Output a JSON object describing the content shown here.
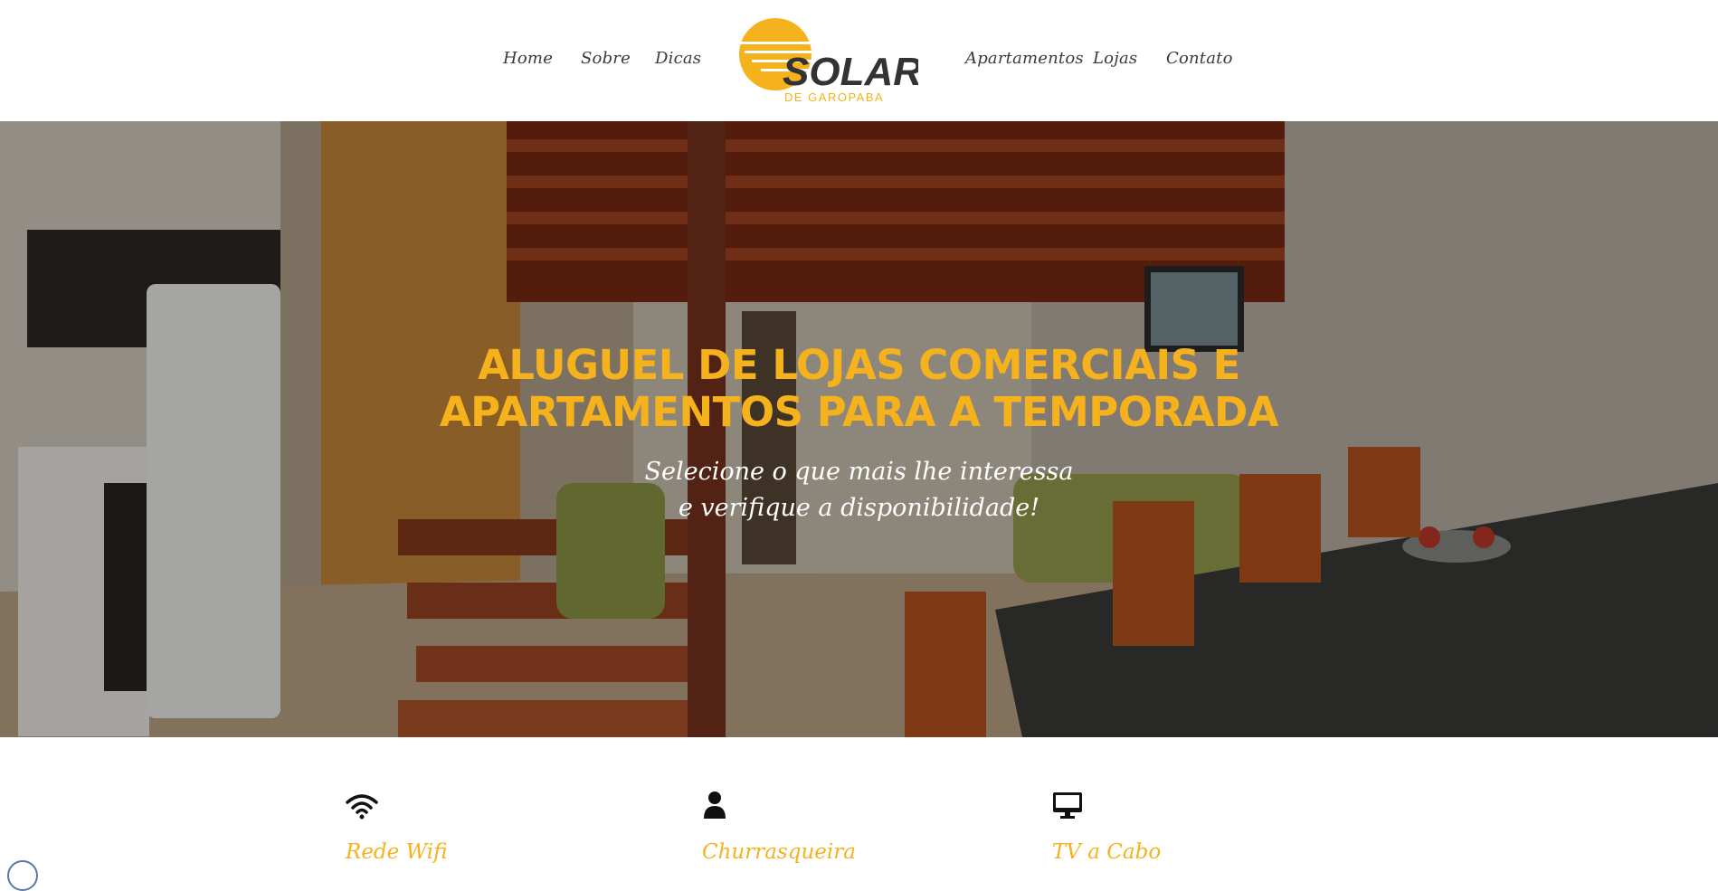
{
  "nav": {
    "left": [
      "Home",
      "Sobre",
      "Dicas"
    ],
    "right": [
      "Apartamentos",
      "Lojas",
      "Contato"
    ]
  },
  "logo": {
    "name": "SOLAR",
    "tagline": "DE GAROPABA"
  },
  "hero": {
    "title_line1": "ALUGUEL DE LOJAS COMERCIAIS E",
    "title_line2": "APARTAMENTOS PARA A TEMPORADA",
    "subtitle_line1": "Selecione o que mais lhe interessa",
    "subtitle_line2": "e verifique a disponibilidade!"
  },
  "features": [
    {
      "icon": "wifi-icon",
      "label": "Rede Wifi"
    },
    {
      "icon": "user-icon",
      "label": "Churrasqueira"
    },
    {
      "icon": "monitor-icon",
      "label": "TV a Cabo"
    }
  ],
  "colors": {
    "accent": "#f6b21c",
    "text": "#3a3a3a"
  }
}
